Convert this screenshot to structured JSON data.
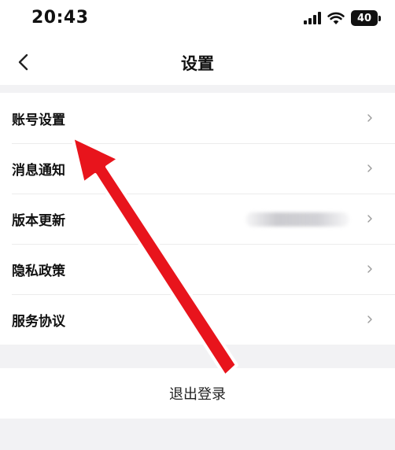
{
  "status_bar": {
    "time": "20:43",
    "battery": "40"
  },
  "header": {
    "title": "设置"
  },
  "menu": {
    "items": [
      {
        "label": "账号设置"
      },
      {
        "label": "消息通知"
      },
      {
        "label": "版本更新"
      },
      {
        "label": "隐私政策"
      },
      {
        "label": "服务协议"
      }
    ]
  },
  "logout": {
    "label": "退出登录"
  },
  "annotation": {
    "color": "#e8141c"
  },
  "icons": [
    "signal-icon",
    "wifi-icon",
    "battery-icon",
    "back-chevron-icon",
    "chevron-right-icon",
    "red-arrow-annotation"
  ]
}
